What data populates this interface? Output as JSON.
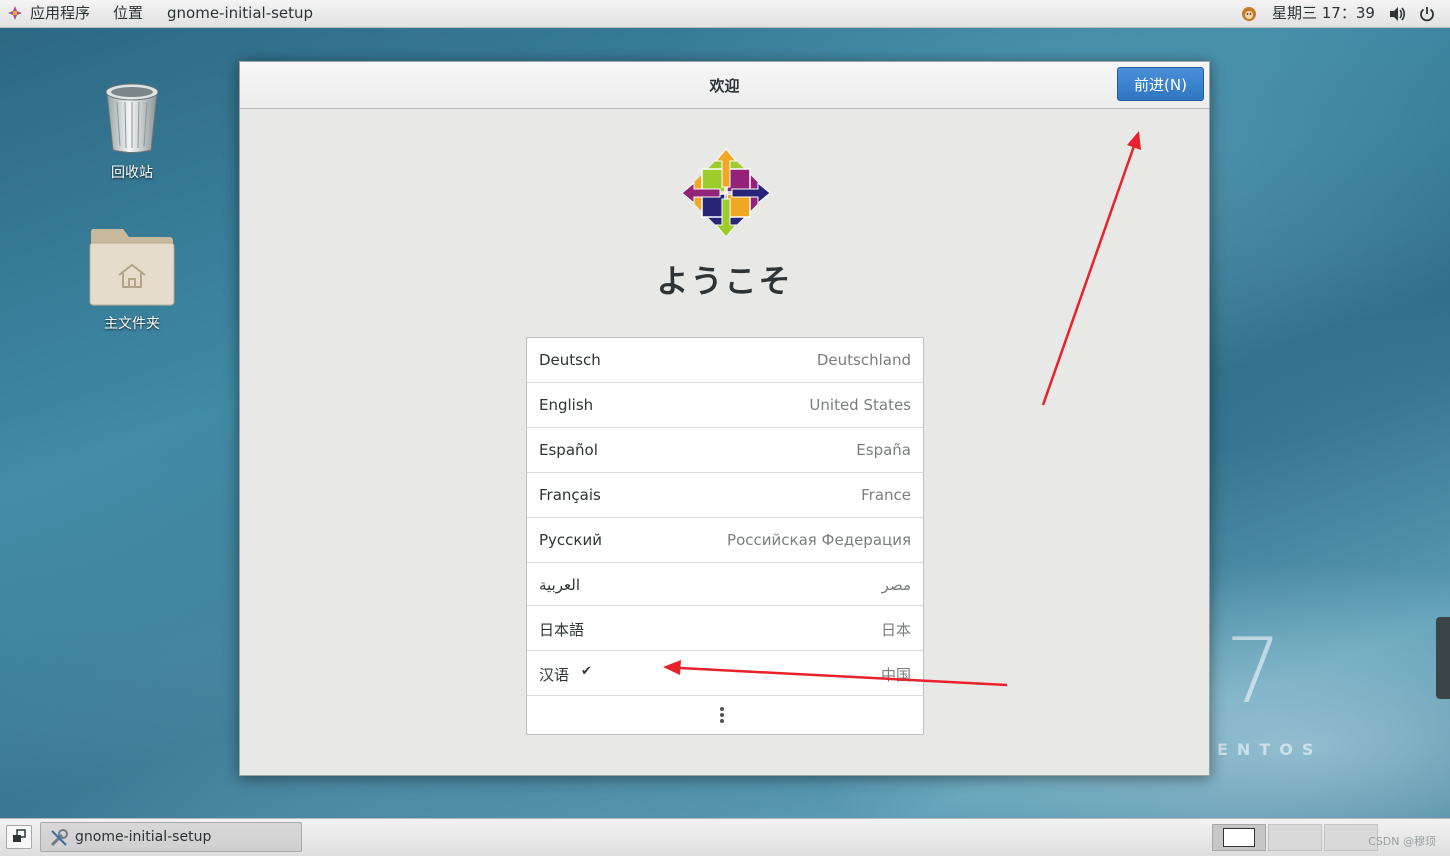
{
  "topbar": {
    "apps_menu": "应用程序",
    "places_menu": "位置",
    "active_app": "gnome-initial-setup",
    "clock": "星期三 17：39"
  },
  "desktop": {
    "trash_label": "回收站",
    "home_folder_label": "主文件夹",
    "wallpaper_number": "7",
    "wallpaper_brand": "ENTOS"
  },
  "window": {
    "title": "欢迎",
    "next_button": "前进(N)",
    "welcome_heading": "ようこそ",
    "languages": [
      {
        "name": "Deutsch",
        "region": "Deutschland",
        "selected": false
      },
      {
        "name": "English",
        "region": "United States",
        "selected": false
      },
      {
        "name": "Español",
        "region": "España",
        "selected": false
      },
      {
        "name": "Français",
        "region": "France",
        "selected": false
      },
      {
        "name": "Русский",
        "region": "Российская Федерация",
        "selected": false
      },
      {
        "name": "العربية",
        "region": "مصر",
        "selected": false
      },
      {
        "name": "日本語",
        "region": "日本",
        "selected": false
      },
      {
        "name": "汉语",
        "region": "中国",
        "selected": true
      }
    ],
    "check_mark": "✔"
  },
  "taskbar": {
    "task_label": "gnome-initial-setup",
    "watermark": "CSDN @穆顼"
  },
  "colors": {
    "accent": "#2f75c0",
    "annotation": "#e8222a"
  }
}
